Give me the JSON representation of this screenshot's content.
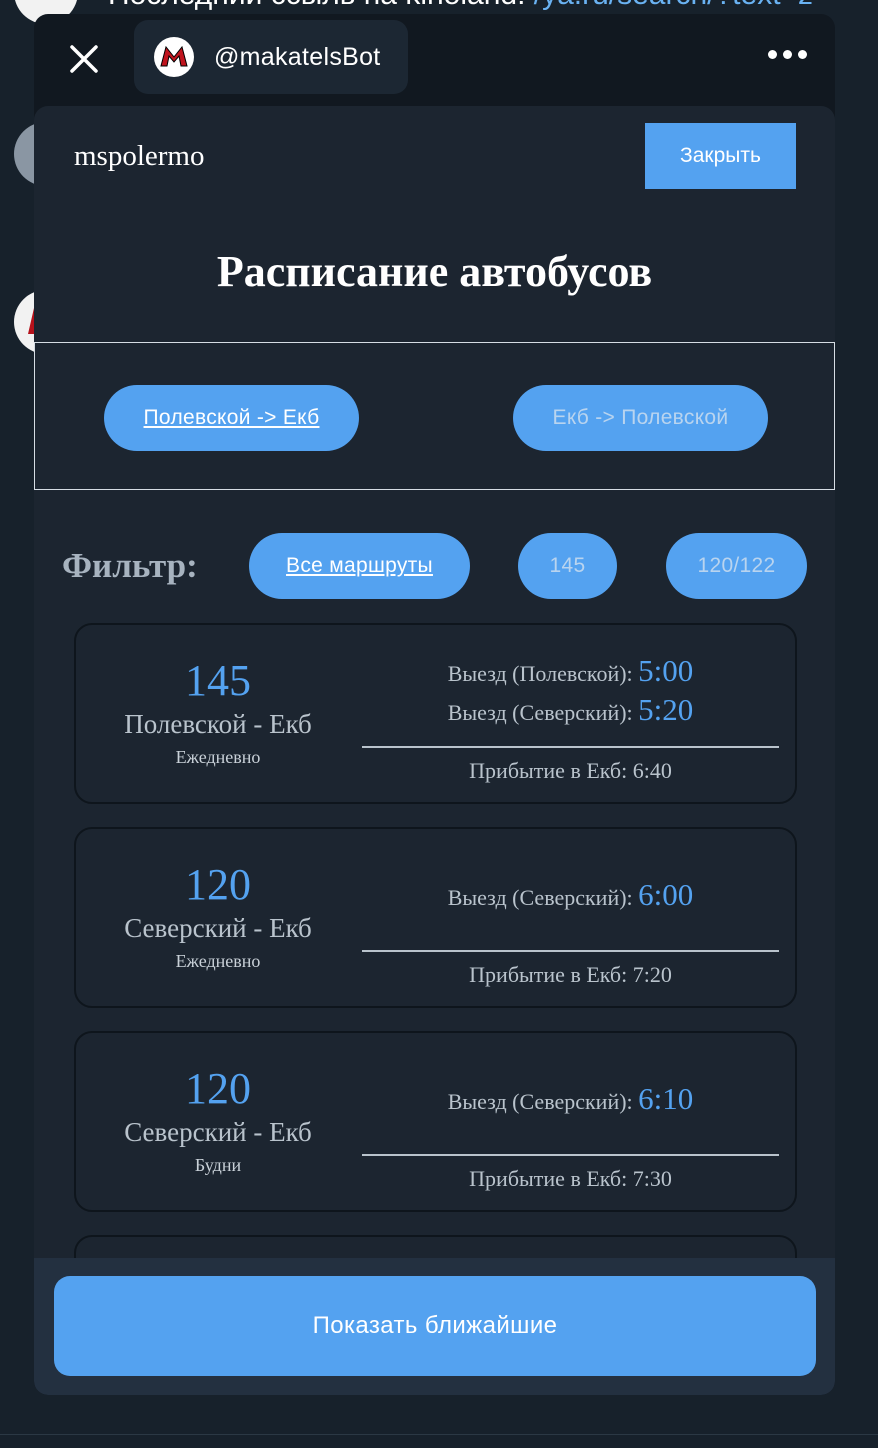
{
  "background_chat": {
    "text_prefix": "Последний ссыль на kinoland: ",
    "text_link": "/ya.ru/search/?text=z"
  },
  "topbar": {
    "bot_username": "@makatelsBot"
  },
  "header": {
    "user_name": "mspolermo",
    "close_button": "Закрыть"
  },
  "title": "Расписание автобусов",
  "directions": [
    {
      "label": "Полевской -> Екб",
      "active": true
    },
    {
      "label": "Екб -> Полевской",
      "active": false
    }
  ],
  "filter": {
    "label": "Фильтр:",
    "options": [
      {
        "label": "Все маршруты",
        "active": true
      },
      {
        "label": "145",
        "active": false
      },
      {
        "label": "120/122",
        "active": false
      }
    ]
  },
  "routes": [
    {
      "number": "145",
      "route": "Полевской - Екб",
      "days": "Ежедневно",
      "departures": [
        {
          "label": "Выезд (Полевской):",
          "time": "5:00"
        },
        {
          "label": "Выезд (Северский):",
          "time": "5:20"
        }
      ],
      "arrival": "Прибытие в Екб: 6:40"
    },
    {
      "number": "120",
      "route": "Северский - Екб",
      "days": "Ежедневно",
      "departures": [
        {
          "label": "Выезд (Северский):",
          "time": "6:00"
        }
      ],
      "arrival": "Прибытие в Екб: 7:20"
    },
    {
      "number": "120",
      "route": "Северский - Екб",
      "days": "Будни",
      "departures": [
        {
          "label": "Выезд (Северский):",
          "time": "6:10"
        }
      ],
      "arrival": "Прибытие в Екб: 7:30"
    }
  ],
  "bottom": {
    "button": "Показать ближайшие"
  },
  "colors": {
    "accent": "#54a2f0",
    "background": "#1c2530",
    "app_bg": "#17212b"
  }
}
